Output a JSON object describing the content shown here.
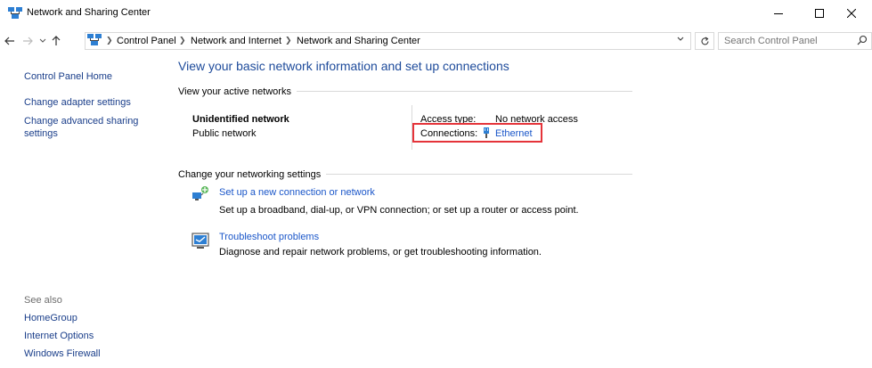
{
  "window": {
    "title": "Network and Sharing Center"
  },
  "address_bar": {
    "breadcrumbs": [
      "Control Panel",
      "Network and Internet",
      "Network and Sharing Center"
    ],
    "search_placeholder": "Search Control Panel"
  },
  "sidebar": {
    "home": "Control Panel Home",
    "links": [
      "Change adapter settings",
      "Change advanced sharing settings"
    ],
    "see_also_label": "See also",
    "see_also": [
      "HomeGroup",
      "Internet Options",
      "Windows Firewall"
    ]
  },
  "main": {
    "title": "View your basic network information and set up connections",
    "active_networks_label": "View your active networks",
    "network": {
      "name": "Unidentified network",
      "type": "Public network",
      "access_type_label": "Access type:",
      "access_type_value": "No network access",
      "connections_label": "Connections:",
      "connection_name": "Ethernet"
    },
    "change_settings_label": "Change your networking settings",
    "tasks": [
      {
        "link": "Set up a new connection or network",
        "description": "Set up a broadband, dial-up, or VPN connection; or set up a router or access point."
      },
      {
        "link": "Troubleshoot problems",
        "description": "Diagnose and repair network problems, or get troubleshooting information."
      }
    ]
  },
  "icons": {
    "app": "network-computers-icon",
    "ethernet": "ethernet-plug-icon",
    "setup": "network-setup-icon",
    "troubleshoot": "troubleshoot-icon"
  },
  "colors": {
    "link": "#1a56c9",
    "sidebar_link": "#1a3e8a",
    "title": "#1e4b9b",
    "highlight": "#e5343a"
  }
}
